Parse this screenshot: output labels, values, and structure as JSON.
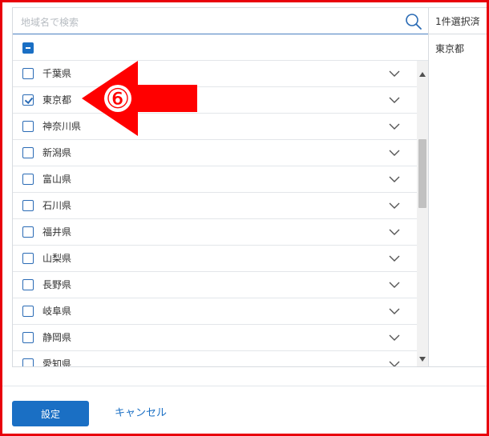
{
  "search": {
    "placeholder": "地域名で検索",
    "value": ""
  },
  "list": {
    "items": [
      {
        "label": "千葉県",
        "checked": false
      },
      {
        "label": "東京都",
        "checked": true
      },
      {
        "label": "神奈川県",
        "checked": false
      },
      {
        "label": "新潟県",
        "checked": false
      },
      {
        "label": "富山県",
        "checked": false
      },
      {
        "label": "石川県",
        "checked": false
      },
      {
        "label": "福井県",
        "checked": false
      },
      {
        "label": "山梨県",
        "checked": false
      },
      {
        "label": "長野県",
        "checked": false
      },
      {
        "label": "岐阜県",
        "checked": false
      },
      {
        "label": "静岡県",
        "checked": false
      },
      {
        "label": "愛知県",
        "checked": false
      }
    ]
  },
  "selected": {
    "count_label": "1件選択済",
    "items": [
      "東京都"
    ]
  },
  "footer": {
    "save_label": "設定",
    "cancel_label": "キャンセル"
  },
  "annotation": {
    "marker": "⑥"
  },
  "colors": {
    "accent": "#1a6fc4",
    "frame": "#e8000b",
    "arrow": "#ff0000"
  }
}
